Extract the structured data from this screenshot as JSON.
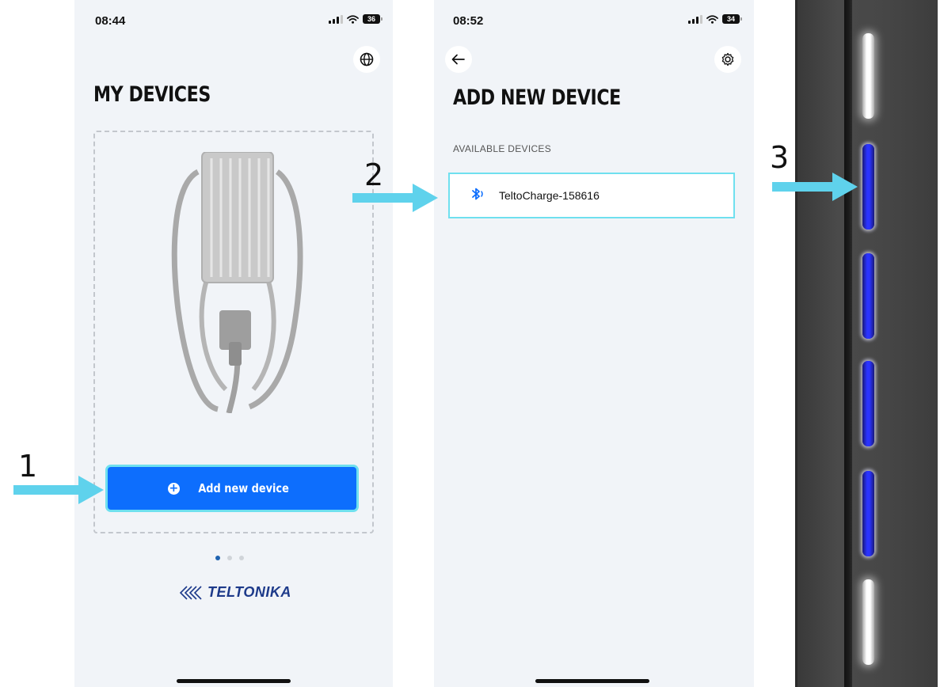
{
  "phone1": {
    "status_time": "08:44",
    "battery": "36",
    "globe_icon": "globe-icon",
    "title": "MY DEVICES",
    "add_button_label": "Add new device",
    "logo_text": "TELTONIKA",
    "carousel": {
      "active_index": 0,
      "count": 3
    }
  },
  "phone2": {
    "status_time": "08:52",
    "battery": "34",
    "back_icon": "arrow-left-icon",
    "settings_icon": "gear-icon",
    "title": "ADD NEW DEVICE",
    "section_label": "AVAILABLE DEVICES",
    "devices": [
      {
        "name": "TeltoCharge-158616",
        "icon": "bluetooth-icon"
      }
    ]
  },
  "annotations": {
    "step1": "1",
    "step2": "2",
    "step3": "3"
  },
  "colors": {
    "accent": "#0d6efd",
    "highlight": "#6fe0ef",
    "arrow": "#5fd2ec",
    "led_blue": "#2a33ff",
    "logo": "#1d3a8a"
  }
}
